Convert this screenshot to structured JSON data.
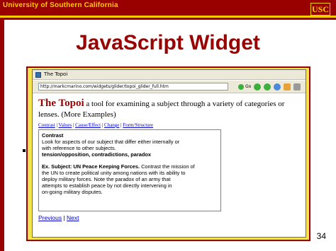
{
  "header": {
    "university": "University of Southern California",
    "logo": "USC"
  },
  "slide": {
    "title": "JavaScript Widget",
    "page_number": "34"
  },
  "browser": {
    "window_title": "The Topoi",
    "address": "http://markcmarino.com/widgets/glider/topoi_glider_full.htm",
    "go_label": "Go"
  },
  "page": {
    "heading_name": "The Topoi",
    "heading_text": " a tool for examining a subject through a variety of categories or lenses. (More Examples)",
    "links": [
      "Contrast",
      "Values",
      "Cause/Effect",
      "Change",
      "Form/Structure"
    ],
    "panel": {
      "section_title": "Contrast",
      "line1": "Look for aspects of our subject that differ either internally or",
      "line2": "with reference to other subjects.",
      "line3": "tension/opposition, contradictions, paradox",
      "example_bold": "Ex. Subject: UN Peace Keeping Forces.",
      "example_l1": " Contrast the mission of",
      "example_l2": "the UN to create political unity among nations with its ability to",
      "example_l3": "deploy military forces. Note the paradox of an army that",
      "example_l4": "attempts to establish peace by not directly intervening in",
      "example_l5": "on-going military disputes."
    },
    "pager": {
      "previous": "Previous",
      "separator": "|",
      "next": "Next"
    }
  },
  "colors": {
    "brand": "#990000",
    "accent": "#ffcc00",
    "frame": "#f4e34e",
    "link": "#0000cc"
  },
  "icons": [
    "usc-logo",
    "window-icon",
    "go-icon",
    "back-icon",
    "forward-icon",
    "refresh-icon",
    "home-icon",
    "print-icon"
  ]
}
